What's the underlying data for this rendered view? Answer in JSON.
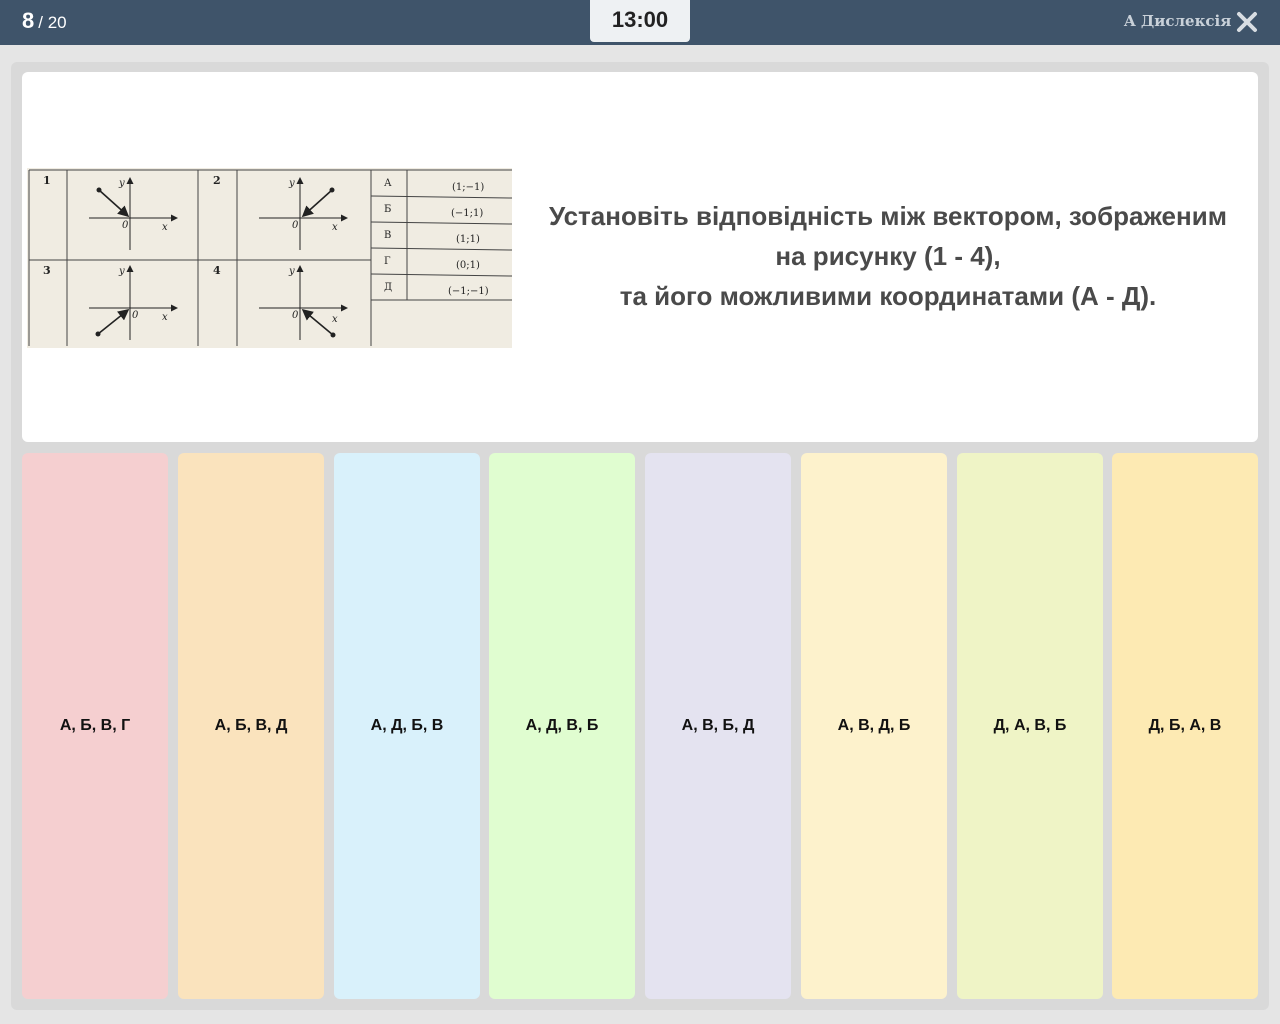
{
  "header": {
    "current": "8",
    "total": "/ 20",
    "timer": "13:00",
    "dyslexia_label": "A Дислексія",
    "close_icon": "close-icon"
  },
  "question": {
    "line1": "Установіть відповідність між вектором, зображеним",
    "line2": "на рисунку (1 - 4),",
    "line3": "та його можливими координатами (А - Д).",
    "figure": {
      "panels": [
        "1",
        "2",
        "3",
        "4"
      ],
      "axis_x": "x",
      "axis_y": "y",
      "origin": "0",
      "table": [
        {
          "letter": "А",
          "coords": "(1;−1)"
        },
        {
          "letter": "Б",
          "coords": "(−1;1)"
        },
        {
          "letter": "В",
          "coords": "(1;1)"
        },
        {
          "letter": "Г",
          "coords": "(0;1)"
        },
        {
          "letter": "Д",
          "coords": "(−1;−1)"
        }
      ]
    }
  },
  "answers": [
    {
      "label": "А, Б, В, Г",
      "color": "#f5cfd0"
    },
    {
      "label": "А, Б, В, Д",
      "color": "#fae3bd"
    },
    {
      "label": "А, Д, Б, В",
      "color": "#d9f1fb"
    },
    {
      "label": "А, Д, В, Б",
      "color": "#e0fdd0"
    },
    {
      "label": "А, В, Б, Д",
      "color": "#e4e3f0"
    },
    {
      "label": "А, В, Д, Б",
      "color": "#fdf2cc"
    },
    {
      "label": "Д, А, В, Б",
      "color": "#eff4c6"
    },
    {
      "label": "Д, Б, А, В",
      "color": "#fdeab3"
    }
  ]
}
